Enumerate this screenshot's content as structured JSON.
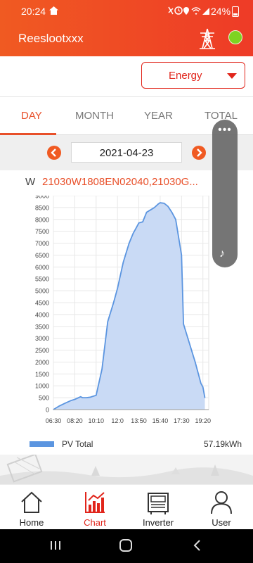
{
  "status_bar": {
    "time": "20:24",
    "battery": "24%",
    "system_icons": [
      "mute-icon",
      "alarm-icon",
      "location-icon",
      "wifi-icon",
      "signal-icon",
      "battery-icon"
    ]
  },
  "app_bar": {
    "title": "Reeslootxxx",
    "status_color": "#7ed321"
  },
  "dropdown": {
    "selected": "Energy"
  },
  "tabs": [
    {
      "label": "DAY",
      "active": true
    },
    {
      "label": "MONTH",
      "active": false
    },
    {
      "label": "YEAR",
      "active": false
    },
    {
      "label": "TOTAL",
      "active": false
    }
  ],
  "date_nav": {
    "date": "2021-04-23"
  },
  "chart_header": {
    "unit": "W",
    "serials": "21030W1808EN02040,21030G..."
  },
  "chart_data": {
    "type": "area",
    "ylim": [
      0,
      9000
    ],
    "yticks": [
      "0",
      "500",
      "1000",
      "1500",
      "2000",
      "2500",
      "3000",
      "3500",
      "4000",
      "4500",
      "5000",
      "5500",
      "6000",
      "6500",
      "7000",
      "7500",
      "8000",
      "8500",
      "9000"
    ],
    "xticks": [
      "06:30",
      "08:20",
      "10:10",
      "12:0",
      "13:50",
      "15:40",
      "17:30",
      "19:20"
    ],
    "x": [
      "06:30",
      "07:00",
      "07:30",
      "08:00",
      "08:20",
      "08:50",
      "09:00",
      "09:20",
      "09:40",
      "10:10",
      "10:40",
      "11:10",
      "11:40",
      "12:00",
      "12:30",
      "13:00",
      "13:20",
      "13:50",
      "14:10",
      "14:30",
      "14:50",
      "15:10",
      "15:30",
      "15:40",
      "16:00",
      "16:20",
      "16:40",
      "17:00",
      "17:30",
      "17:40",
      "18:10",
      "18:40",
      "19:10",
      "19:20",
      "19:30"
    ],
    "series": [
      {
        "name": "PV Total",
        "color": "#5b95e0",
        "fill": "#c9daf5",
        "values": [
          0,
          150,
          270,
          380,
          430,
          540,
          500,
          500,
          520,
          600,
          1700,
          3700,
          4500,
          5100,
          6200,
          7000,
          7400,
          7850,
          7900,
          8300,
          8400,
          8500,
          8650,
          8700,
          8680,
          8550,
          8300,
          8000,
          6500,
          3600,
          2800,
          2000,
          1100,
          950,
          500
        ]
      }
    ],
    "legend": "bottom",
    "total_label": "57.19kWh",
    "grid": true
  },
  "bottom_nav": [
    {
      "label": "Home",
      "icon": "home-icon",
      "active": false
    },
    {
      "label": "Chart",
      "icon": "chart-icon",
      "active": true
    },
    {
      "label": "Inverter",
      "icon": "inverter-icon",
      "active": false
    },
    {
      "label": "User",
      "icon": "user-icon",
      "active": false
    }
  ]
}
